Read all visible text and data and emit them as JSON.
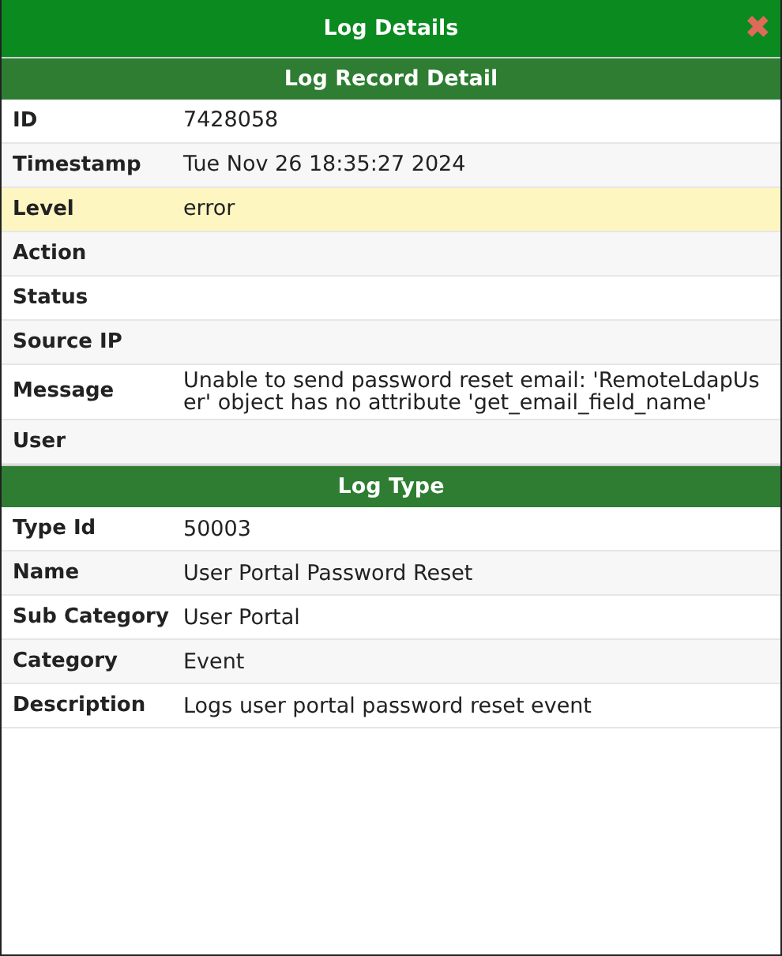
{
  "window": {
    "title": "Log Details",
    "close_icon": "✖"
  },
  "sections": [
    {
      "title": "Log Record Detail",
      "rows": [
        {
          "label": "ID",
          "value": "7428058",
          "highlighted": false
        },
        {
          "label": "Timestamp",
          "value": "Tue Nov 26 18:35:27 2024",
          "highlighted": false
        },
        {
          "label": "Level",
          "value": "error",
          "highlighted": true
        },
        {
          "label": "Action",
          "highlighted": false
        },
        {
          "label": "Status",
          "highlighted": false
        },
        {
          "label": "Source IP",
          "highlighted": false
        },
        {
          "label": "Message",
          "value": "Unable to send password reset email: 'RemoteLdapUser' object has no attribute 'get_email_field_name'",
          "highlighted": false
        },
        {
          "label": "User",
          "highlighted": false
        }
      ]
    },
    {
      "title": "Log Type",
      "rows": [
        {
          "label": "Type Id",
          "value": "50003",
          "highlighted": false
        },
        {
          "label": "Name",
          "value": "User Portal Password Reset",
          "highlighted": false
        },
        {
          "label": "Sub Category",
          "value": "User Portal",
          "highlighted": false
        },
        {
          "label": "Category",
          "value": "Event",
          "highlighted": false
        },
        {
          "label": "Description",
          "value": "Logs user portal password reset event",
          "highlighted": false
        }
      ]
    }
  ]
}
